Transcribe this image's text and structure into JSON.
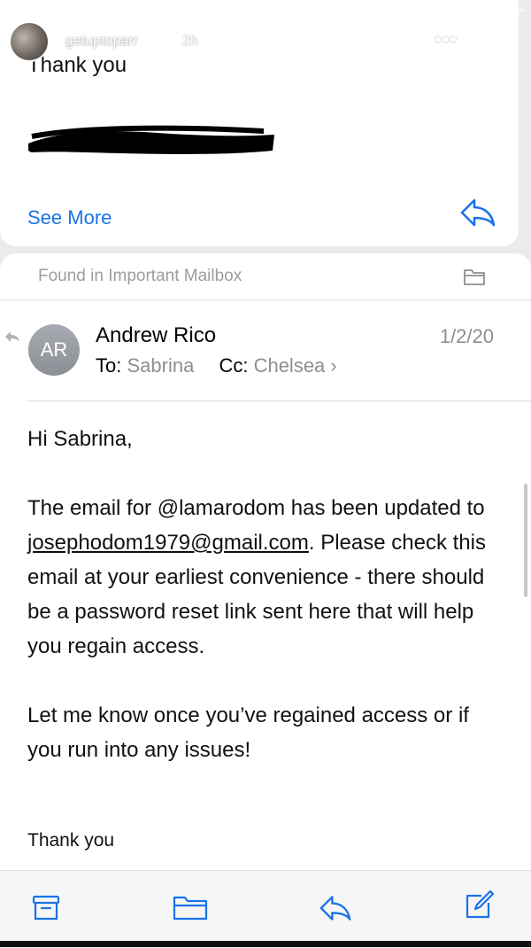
{
  "story": {
    "username": "getuptoparr",
    "time": "2h"
  },
  "prev_email": {
    "signoff": "Thank you",
    "see_more": "See More"
  },
  "mailbox": {
    "found_in": "Found in Important Mailbox"
  },
  "email": {
    "avatar_initials": "AR",
    "sender": "Andrew Rico",
    "date": "1/2/20",
    "to_label": "To:",
    "to_value": "Sabrina",
    "cc_label": "Cc:",
    "cc_value": "Chelsea",
    "greeting": "Hi Sabrina,",
    "para1_a": "The email for @lamarodom has been updated to ",
    "para1_link": "josephodom1979@gmail.com",
    "para1_b": ". Please check this email at your earliest convenience - there should be a password reset link sent here that will help you regain access.",
    "para2": "Let me know once you’ve regained access or if you run into any issues!",
    "signoff": "Thank you"
  },
  "colors": {
    "link_blue": "#1a73e8",
    "secondary_gray": "#8e8e93",
    "avatar_gray": "#9a9ca4"
  },
  "icons": {
    "story_more": "more-horizontal-icon",
    "story_close": "close-icon",
    "reply": "reply-arrow-icon",
    "folder": "folder-icon",
    "archive": "archive-box-icon",
    "compose": "compose-icon"
  }
}
